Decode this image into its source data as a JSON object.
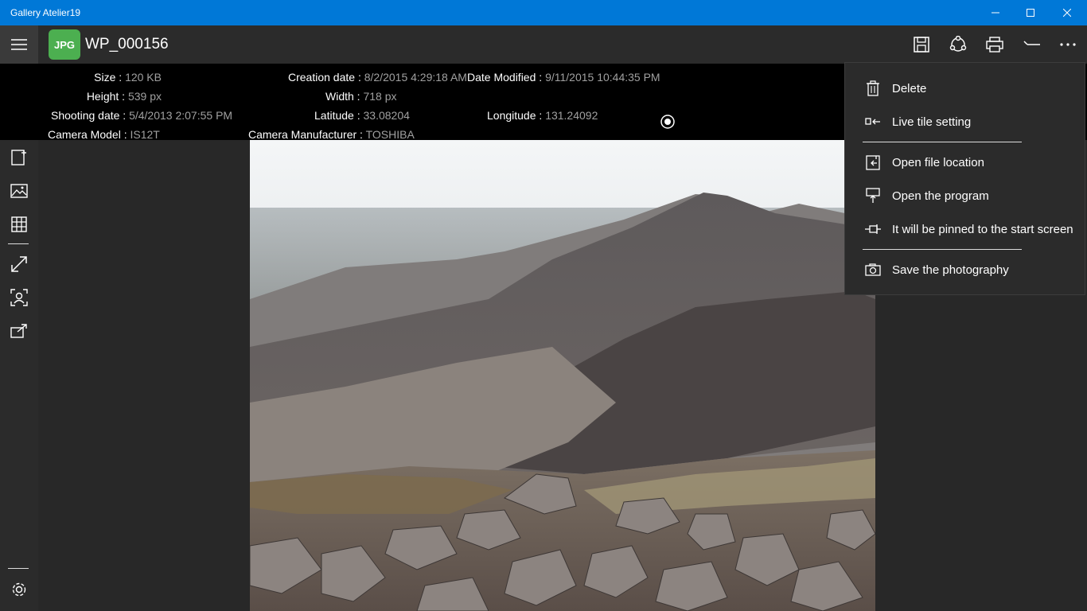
{
  "app": {
    "title": "Gallery Atelier19"
  },
  "file": {
    "type_badge": "JPG",
    "name": "WP_000156"
  },
  "info": {
    "size_label": "Size :",
    "size": "120 KB",
    "creation_label": "Creation date :",
    "creation": "8/2/2015 4:29:18 AM",
    "modified_label": "Date Modified :",
    "modified": "9/11/2015 10:44:35 PM",
    "height_label": "Height :",
    "height": "539 px",
    "width_label": "Width :",
    "width": "718 px",
    "shooting_label": "Shooting date :",
    "shooting": "5/4/2013 2:07:55 PM",
    "latitude_label": "Latitude :",
    "latitude": "33.08204",
    "longitude_label": "Longitude :",
    "longitude": "131.24092",
    "camera_model_label": "Camera Model :",
    "camera_model": "IS12T",
    "camera_maker_label": "Camera Manufacturer :",
    "camera_maker": "TOSHIBA"
  },
  "menu": {
    "delete": "Delete",
    "live_tile": "Live tile setting",
    "open_location": "Open file location",
    "open_program": "Open the program",
    "pin_start": "It will be pinned to the start screen",
    "save_photo": "Save the photography"
  },
  "colors": {
    "titlebar": "#0078d7",
    "badge": "#4caf50"
  }
}
